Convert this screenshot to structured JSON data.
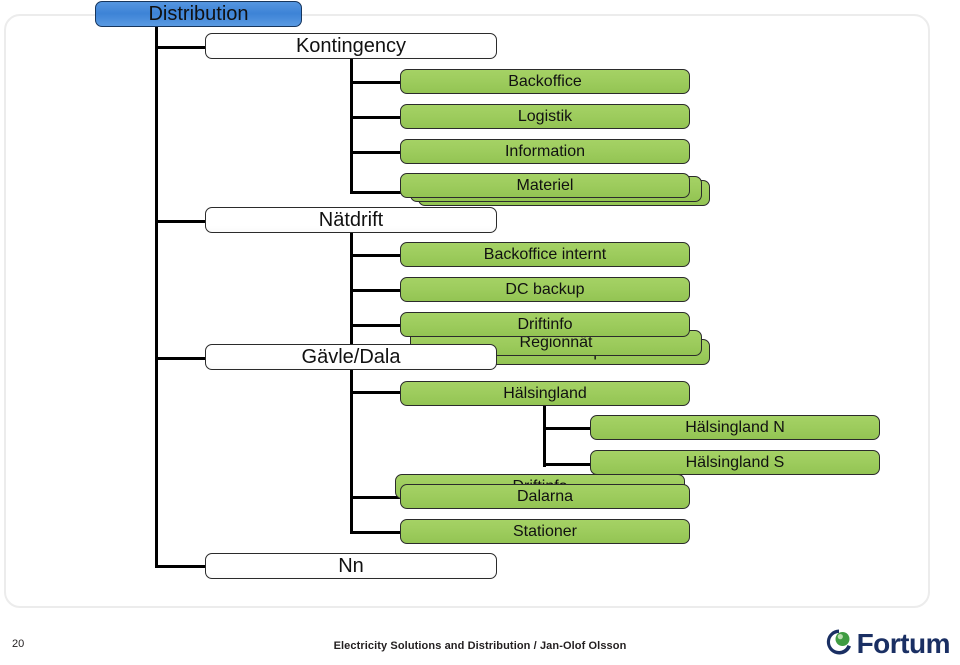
{
  "slide": {
    "footer": {
      "page_number": "20",
      "credit": "Electricity Solutions and Distribution / Jan-Olof Olsson",
      "brand": "Fortum",
      "brand_icon": "fortum-sphere-icon"
    },
    "colors": {
      "root_fill": "#3d83d6",
      "branch_fill": "#ffffff",
      "leaf_fill": "#9ccb5c",
      "line": "#000000",
      "frame": "#ececec",
      "brand_text": "#1a2f63"
    }
  },
  "org_chart": {
    "root": {
      "label": "Distribution"
    },
    "branches": [
      {
        "label": "Kontingency",
        "children": [
          {
            "label": "Backoffice"
          },
          {
            "label": "Logistik"
          },
          {
            "label": "Information"
          },
          {
            "label": "Materiel"
          },
          {
            "label": ""
          },
          {
            "label": ""
          }
        ]
      },
      {
        "label": "Nätdrift",
        "children": [
          {
            "label": "Backoffice internt"
          },
          {
            "label": "DC backup"
          },
          {
            "label": "Driftinfo"
          },
          {
            "label": "Regionnät"
          },
          {
            "label": "Beredskap"
          }
        ]
      },
      {
        "label": "Gävle/Dala",
        "children": [
          {
            "label": "Hälsingland"
          },
          {
            "label": "Hälsingland N"
          },
          {
            "label": "Hälsingland S"
          },
          {
            "label": "Driftinfo"
          },
          {
            "label": "Dalarna"
          },
          {
            "label": "Stationer"
          }
        ]
      },
      {
        "label": "Nn",
        "children": []
      }
    ]
  }
}
